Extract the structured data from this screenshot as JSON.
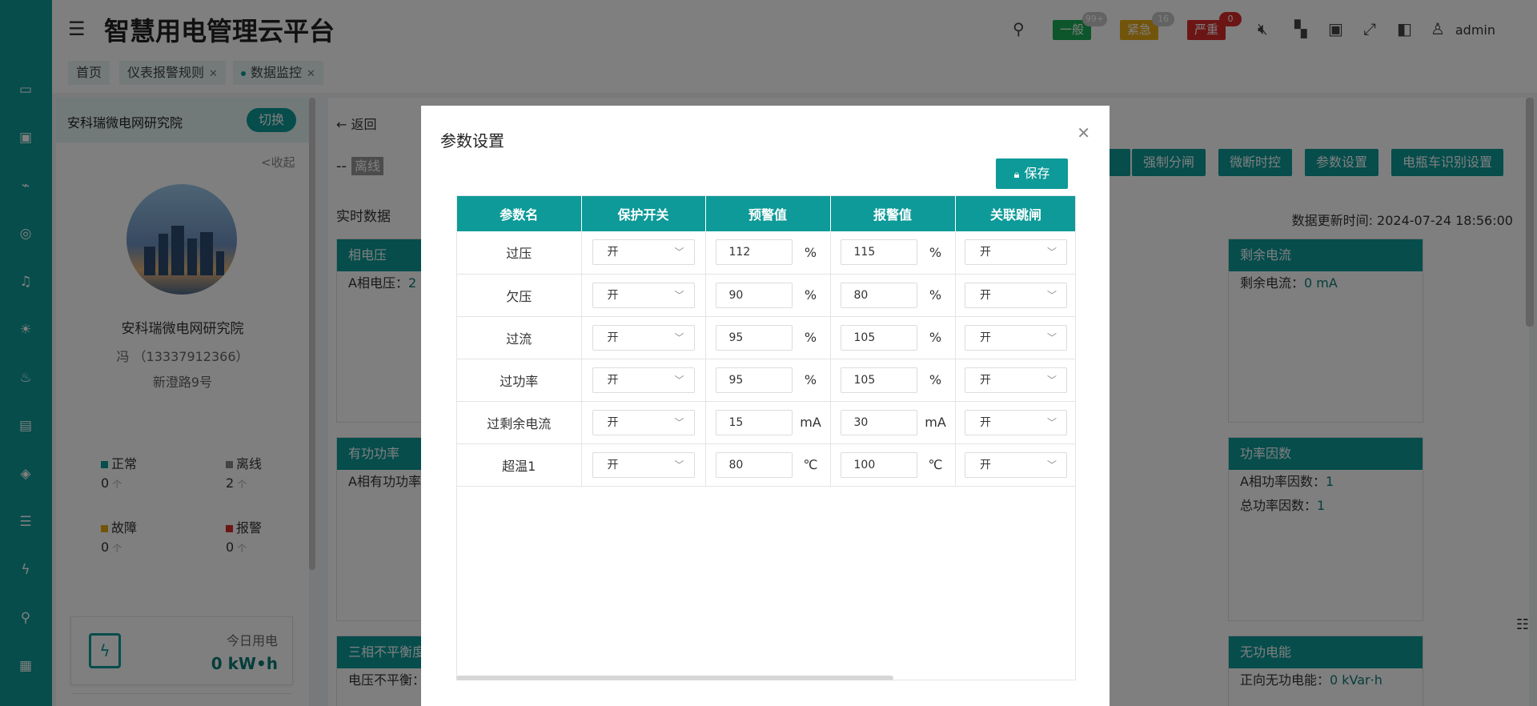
{
  "app": {
    "title": "智慧用电管理云平台",
    "user": "admin"
  },
  "alarm_tags": [
    {
      "label": "一般",
      "count": "99+",
      "color": "#1aaa55"
    },
    {
      "label": "紧急",
      "count": "16",
      "color": "#e6a817"
    },
    {
      "label": "严重",
      "count": "0",
      "color": "#d92b2b"
    }
  ],
  "tabs": [
    {
      "label": "首页"
    },
    {
      "label": "仪表报警规则"
    },
    {
      "label": "数据监控"
    }
  ],
  "org": {
    "name": "安科瑞微电网研究院",
    "switch_label": "切换",
    "collapse_label": "<收起",
    "title": "安科瑞微电网研究院",
    "contact": "冯 （13337912366）",
    "address": "新澄路9号",
    "stats": [
      {
        "label": "正常",
        "value": "0",
        "unit": "个",
        "color": "#0d9a98"
      },
      {
        "label": "离线",
        "value": "2",
        "unit": "个",
        "color": "#888888"
      },
      {
        "label": "故障",
        "value": "0",
        "unit": "个",
        "color": "#e6a817"
      },
      {
        "label": "报警",
        "value": "0",
        "unit": "个",
        "color": "#d92b2b"
      }
    ],
    "today_label": "今日用电",
    "today_value": "0 kW•h"
  },
  "main": {
    "back_label": "返回",
    "status_prefix": "--",
    "status_label": "离线",
    "actions": [
      "强制分闸",
      "微断时控",
      "参数设置",
      "电瓶车识别设置"
    ],
    "realtime_title": "实时数据",
    "update_time": "数据更新时间: 2024-07-24 18:56:00",
    "cards": [
      {
        "title": "相电压",
        "rows": [
          {
            "label": "A相电压：",
            "value": "2"
          }
        ]
      },
      {
        "title": "有功功率",
        "rows": [
          {
            "label": "A相有功功率",
            "value": ""
          }
        ]
      },
      {
        "title": "三相不平衡度",
        "rows": [
          {
            "label": "电压不平衡：",
            "value": ""
          }
        ]
      },
      {
        "title": "剩余电流",
        "rows": [
          {
            "label": "剩余电流：",
            "value": "0 mA"
          }
        ]
      },
      {
        "title": "功率因数",
        "rows": [
          {
            "label": "A相功率因数：",
            "value": "1"
          },
          {
            "label": "总功率因数：",
            "value": "1"
          }
        ]
      },
      {
        "title": "无功电能",
        "rows": [
          {
            "label": "正向无功电能：",
            "value": "0 kVar·h"
          }
        ]
      }
    ]
  },
  "modal": {
    "title": "参数设置",
    "save_label": "保存",
    "columns": [
      "参数名",
      "保护开关",
      "预警值",
      "报警值",
      "关联跳闸"
    ],
    "rows": [
      {
        "name": "过压",
        "switch": "开",
        "warn": "112",
        "warn_unit": "%",
        "alarm": "115",
        "alarm_unit": "%",
        "trip": "开"
      },
      {
        "name": "欠压",
        "switch": "开",
        "warn": "90",
        "warn_unit": "%",
        "alarm": "80",
        "alarm_unit": "%",
        "trip": "开"
      },
      {
        "name": "过流",
        "switch": "开",
        "warn": "95",
        "warn_unit": "%",
        "alarm": "105",
        "alarm_unit": "%",
        "trip": "开"
      },
      {
        "name": "过功率",
        "switch": "开",
        "warn": "95",
        "warn_unit": "%",
        "alarm": "105",
        "alarm_unit": "%",
        "trip": "开"
      },
      {
        "name": "过剩余电流",
        "switch": "开",
        "warn": "15",
        "warn_unit": "mA",
        "alarm": "30",
        "alarm_unit": "mA",
        "trip": "开"
      },
      {
        "name": "超温1",
        "switch": "开",
        "warn": "80",
        "warn_unit": "℃",
        "alarm": "100",
        "alarm_unit": "℃",
        "trip": "开"
      }
    ]
  }
}
